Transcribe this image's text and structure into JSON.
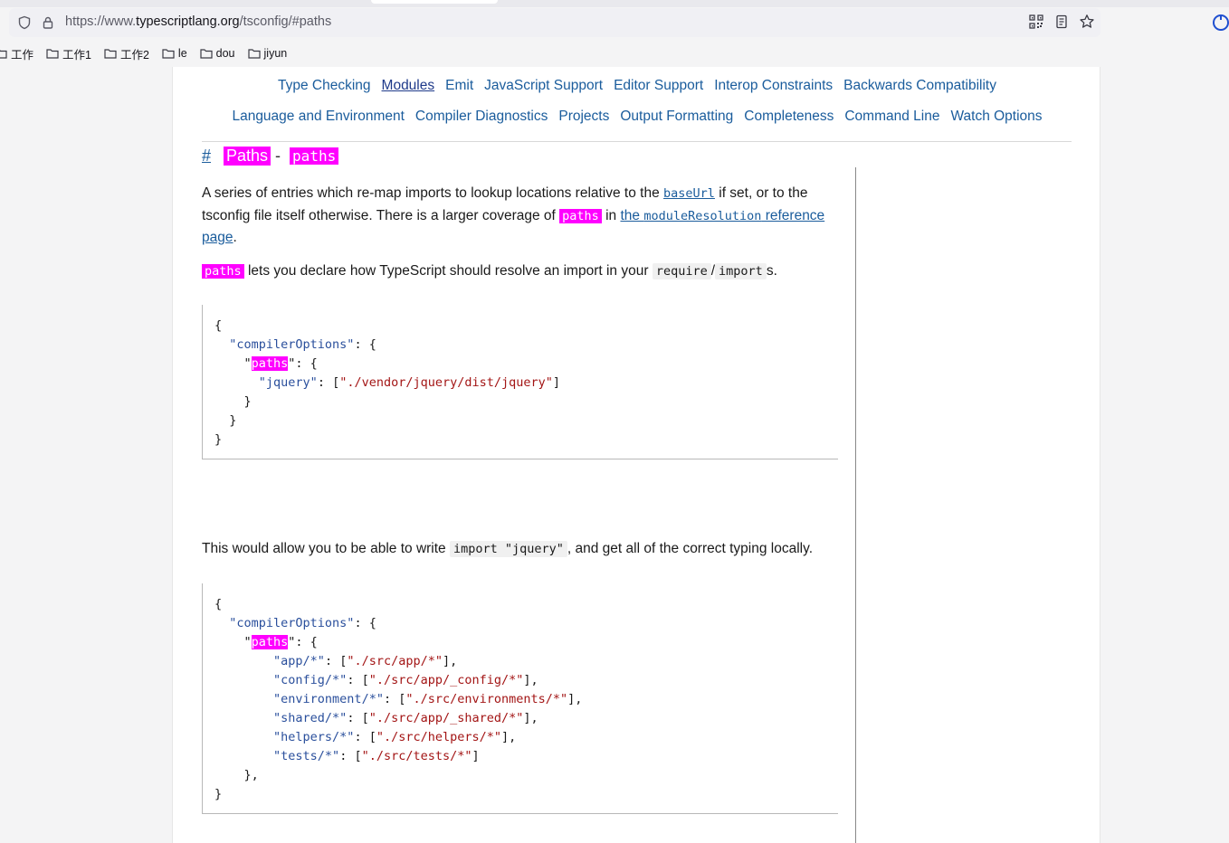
{
  "browser": {
    "url_prefix": "https://www.",
    "url_host": "typescriptlang.org",
    "url_path": "/tsconfig/#paths",
    "bookmarks": [
      "工作",
      "工作1",
      "工作2",
      "le",
      "dou",
      "jiyun"
    ]
  },
  "nav": {
    "row1": [
      "Type Checking",
      "Modules",
      "Emit",
      "JavaScript Support",
      "Editor Support",
      "Interop Constraints",
      "Backwards Compatibility"
    ],
    "row2": [
      "Language and Environment",
      "Compiler Diagnostics",
      "Projects",
      "Output Formatting",
      "Completeness",
      "Command Line",
      "Watch Options"
    ],
    "active": "Modules"
  },
  "option": {
    "hash": "#",
    "title": "Paths",
    "dash": "-",
    "code": "paths"
  },
  "body": {
    "p1_a": "A series of entries which re-map imports to lookup locations relative to the ",
    "p1_baseurl": "baseUrl",
    "p1_b": " if set, or to the tsconfig file itself otherwise. There is a larger coverage of ",
    "p1_paths": "paths",
    "p1_c": " in ",
    "p1_link_the": "the ",
    "p1_link_code": "moduleResolution",
    "p1_link_rest": " reference page",
    "p1_d": ".",
    "p2_paths": "paths",
    "p2_a": " lets you declare how TypeScript should resolve an import in your ",
    "p2_require": "require",
    "p2_slash": "/",
    "p2_import": "import",
    "p2_b": "s.",
    "p3_a": "This would allow you to be able to write ",
    "p3_code": "import \"jquery\"",
    "p3_b": ", and get all of the correct typing locally."
  },
  "code1": {
    "compilerOptions": "\"compilerOptions\"",
    "paths": "paths",
    "jquery_key": "\"jquery\"",
    "jquery_val": "\"./vendor/jquery/dist/jquery\""
  },
  "code2": {
    "compilerOptions": "\"compilerOptions\"",
    "paths": "paths",
    "entries": [
      {
        "key": "\"app/*\"",
        "val": "\"./src/app/*\"",
        "end": "],"
      },
      {
        "key": "\"config/*\"",
        "val": "\"./src/app/_config/*\"",
        "end": "],"
      },
      {
        "key": "\"environment/*\"",
        "val": "\"./src/environments/*\"",
        "end": "],"
      },
      {
        "key": "\"shared/*\"",
        "val": "\"./src/app/_shared/*\"",
        "end": "],"
      },
      {
        "key": "\"helpers/*\"",
        "val": "\"./src/helpers/*\"",
        "end": "],"
      },
      {
        "key": "\"tests/*\"",
        "val": "\"./src/tests/*\"",
        "end": "]"
      }
    ]
  }
}
